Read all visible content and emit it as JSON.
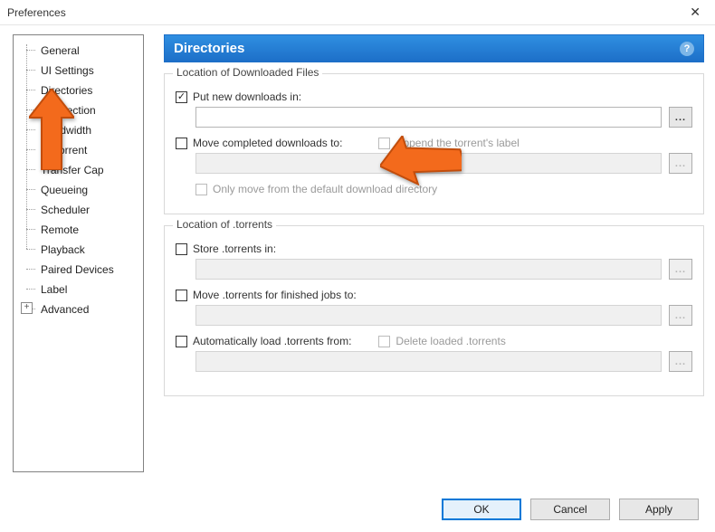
{
  "window": {
    "title": "Preferences"
  },
  "sidebar": {
    "items": [
      {
        "label": "General"
      },
      {
        "label": "UI Settings"
      },
      {
        "label": "Directories"
      },
      {
        "label": "Connection"
      },
      {
        "label": "Bandwidth"
      },
      {
        "label": "BitTorrent"
      },
      {
        "label": "Transfer Cap"
      },
      {
        "label": "Queueing"
      },
      {
        "label": "Scheduler"
      },
      {
        "label": "Remote"
      },
      {
        "label": "Playback"
      },
      {
        "label": "Paired Devices"
      },
      {
        "label": "Label"
      },
      {
        "label": "Advanced",
        "expandable": true
      }
    ]
  },
  "panel": {
    "title": "Directories",
    "group_downloads": {
      "title": "Location of Downloaded Files",
      "put_new": {
        "checked": true,
        "label": "Put new downloads in:",
        "value": ""
      },
      "move_completed": {
        "checked": false,
        "label": "Move completed downloads to:",
        "value": ""
      },
      "append_label": {
        "checked": false,
        "label": "Append the torrent's label"
      },
      "only_move_default": {
        "checked": false,
        "label": "Only move from the default download directory"
      }
    },
    "group_torrents": {
      "title": "Location of .torrents",
      "store_in": {
        "checked": false,
        "label": "Store .torrents in:",
        "value": ""
      },
      "move_finished": {
        "checked": false,
        "label": "Move .torrents for finished jobs to:",
        "value": ""
      },
      "auto_load": {
        "checked": false,
        "label": "Automatically load .torrents from:",
        "value": ""
      },
      "delete_loaded": {
        "checked": false,
        "label": "Delete loaded .torrents"
      }
    }
  },
  "buttons": {
    "ok": "OK",
    "cancel": "Cancel",
    "apply": "Apply"
  },
  "glyphs": {
    "ellipsis": "..."
  }
}
